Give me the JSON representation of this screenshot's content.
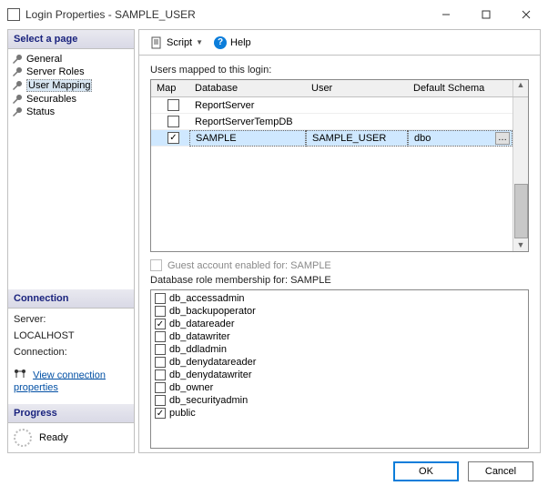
{
  "title": "Login Properties - SAMPLE_USER",
  "sidebar": {
    "header": "Select a page",
    "items": [
      {
        "label": "General"
      },
      {
        "label": "Server Roles"
      },
      {
        "label": "User Mapping",
        "selected": true
      },
      {
        "label": "Securables"
      },
      {
        "label": "Status"
      }
    ]
  },
  "connection": {
    "header": "Connection",
    "server_label": "Server:",
    "server_value": "LOCALHOST",
    "conn_label": "Connection:",
    "view_link": "View connection properties"
  },
  "progress": {
    "header": "Progress",
    "status": "Ready"
  },
  "toolbar": {
    "script_label": "Script",
    "help_label": "Help"
  },
  "grid": {
    "caption": "Users mapped to this login:",
    "columns": {
      "map": "Map",
      "db": "Database",
      "user": "User",
      "schema": "Default Schema"
    },
    "rows": [
      {
        "checked": false,
        "db": "ReportServer",
        "user": "",
        "schema": ""
      },
      {
        "checked": false,
        "db": "ReportServerTempDB",
        "user": "",
        "schema": ""
      },
      {
        "checked": true,
        "db": "SAMPLE",
        "user": "SAMPLE_USER",
        "schema": "dbo",
        "selected": true
      }
    ]
  },
  "guest_label": "Guest account enabled for: SAMPLE",
  "roles": {
    "caption": "Database role membership for: SAMPLE",
    "items": [
      {
        "label": "db_accessadmin",
        "checked": false
      },
      {
        "label": "db_backupoperator",
        "checked": false
      },
      {
        "label": "db_datareader",
        "checked": true
      },
      {
        "label": "db_datawriter",
        "checked": false
      },
      {
        "label": "db_ddladmin",
        "checked": false
      },
      {
        "label": "db_denydatareader",
        "checked": false
      },
      {
        "label": "db_denydatawriter",
        "checked": false
      },
      {
        "label": "db_owner",
        "checked": false
      },
      {
        "label": "db_securityadmin",
        "checked": false
      },
      {
        "label": "public",
        "checked": true
      }
    ]
  },
  "buttons": {
    "ok": "OK",
    "cancel": "Cancel"
  }
}
